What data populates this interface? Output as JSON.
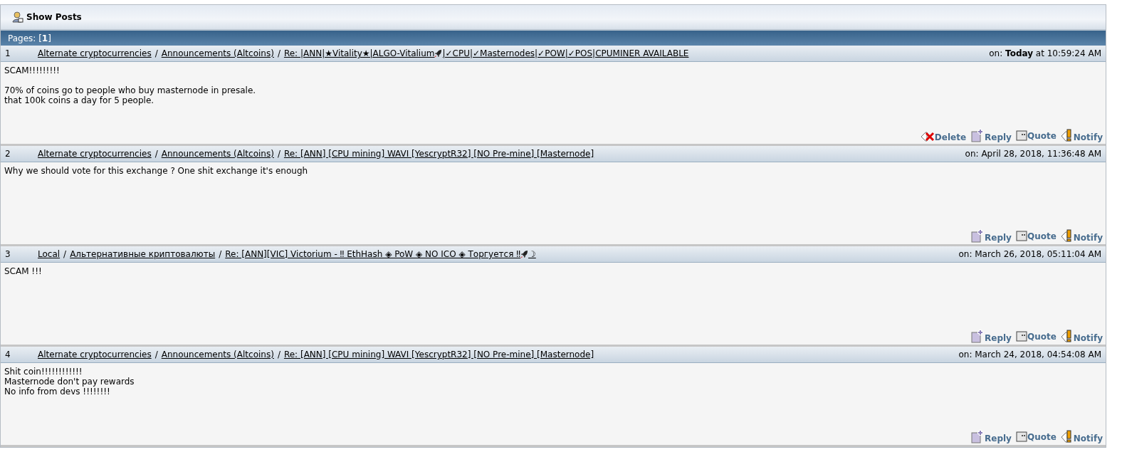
{
  "title": "Show Posts",
  "pages": {
    "label": "Pages: [",
    "current": "1",
    "end": "]"
  },
  "posts": [
    {
      "number": "1",
      "separators": [
        "/",
        "/"
      ],
      "board": "Alternate cryptocurrencies",
      "subboard": "Announcements (Altcoins)",
      "title_parts": [
        "Re: |ANN|★Vitality★|ALGO-Vitalium",
        "|✓CPU|✓Masternodes|✓POW|✓POS|CPUMINER AVAILABLE"
      ],
      "date": "on: **Today** at 10:59:24 AM",
      "body": [
        [
          "SCAM!!!!!!!!!"
        ],
        [
          "70% of coins go to people who buy masternode in presale.",
          "that 100k coins a day for 5 people."
        ]
      ],
      "actions": [
        {
          "kind": "delete",
          "label": "Delete"
        },
        {
          "kind": "reply",
          "label": "Reply"
        },
        {
          "kind": "quote",
          "label": "Quote"
        },
        {
          "kind": "notify",
          "label": "Notify"
        }
      ]
    },
    {
      "number": "2",
      "separators": [
        "/",
        "/"
      ],
      "board": "Alternate cryptocurrencies",
      "subboard": "Announcements (Altcoins)",
      "title_parts": [
        "Re: [ANN] [CPU mining] WAVI [YescryptR32] [NO Pre-mine] [Masternode]"
      ],
      "date": "on: April 28, 2018, 11:36:48 AM",
      "body": [
        [
          "Why we should vote for this exchange ? One shit exchange it's enough"
        ]
      ],
      "actions": [
        {
          "kind": "reply",
          "label": "Reply"
        },
        {
          "kind": "quote",
          "label": "Quote"
        },
        {
          "kind": "notify",
          "label": "Notify"
        }
      ]
    },
    {
      "number": "3",
      "separators": [
        "/",
        "/"
      ],
      "board": "Local",
      "subboard": "Альтернативные криптовалюты",
      "title_parts": [
        "Re: [ANN][VIC] Victorium - ‼ EthHash ◈ PoW ◈ NO ICO ◈ Торгуется ‼ ",
        "☽"
      ],
      "date": "on: March 26, 2018, 05:11:04 AM",
      "body": [
        [
          "SCAM !!!"
        ]
      ],
      "actions": [
        {
          "kind": "reply",
          "label": "Reply"
        },
        {
          "kind": "quote",
          "label": "Quote"
        },
        {
          "kind": "notify",
          "label": "Notify"
        }
      ]
    },
    {
      "number": "4",
      "separators": [
        "/",
        "/"
      ],
      "board": "Alternate cryptocurrencies",
      "subboard": "Announcements (Altcoins)",
      "title_parts": [
        "Re: [ANN] [CPU mining] WAVI [YescryptR32] [NO Pre-mine] [Masternode]"
      ],
      "date": "on: March 24, 2018, 04:54:08 AM",
      "body": [
        [
          "Shit coin!!!!!!!!!!!!",
          "Masternode don't pay rewards",
          "No info from devs !!!!!!!!"
        ]
      ],
      "actions": [
        {
          "kind": "reply",
          "label": "Reply"
        },
        {
          "kind": "quote",
          "label": "Quote"
        },
        {
          "kind": "notify",
          "label": "Notify"
        }
      ]
    }
  ]
}
